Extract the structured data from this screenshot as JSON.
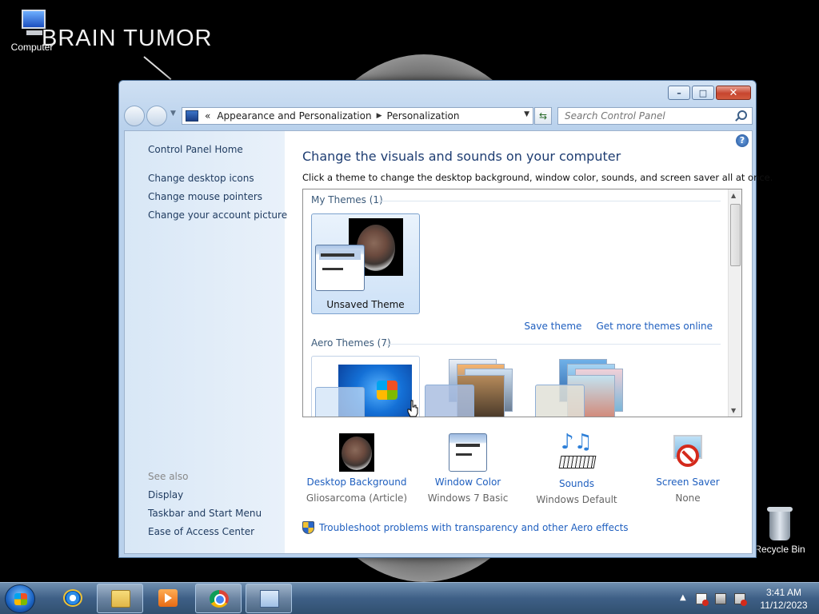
{
  "desktop": {
    "wallpaper_text": "BRAIN TUMOR",
    "icons": {
      "computer": "Computer",
      "recycle_bin": "Recycle Bin"
    }
  },
  "window": {
    "title_buttons": {
      "minimize": "–",
      "maximize": "□",
      "close": "✕"
    },
    "address": {
      "prefix": "«",
      "crumbs": [
        "Appearance and Personalization",
        "Personalization"
      ]
    },
    "search": {
      "placeholder": "Search Control Panel"
    },
    "left_pane": {
      "home": "Control Panel Home",
      "links": [
        "Change desktop icons",
        "Change mouse pointers",
        "Change your account picture"
      ],
      "see_also_label": "See also",
      "see_also": [
        "Display",
        "Taskbar and Start Menu",
        "Ease of Access Center"
      ]
    },
    "main": {
      "title": "Change the visuals and sounds on your computer",
      "subtitle": "Click a theme to change the desktop background, window color, sounds, and screen saver all at once.",
      "my_themes_label": "My Themes (1)",
      "unsaved_theme_name": "Unsaved Theme",
      "save_theme": "Save theme",
      "get_more_themes": "Get more themes online",
      "aero_themes_label": "Aero Themes (7)",
      "bottom_items": [
        {
          "label": "Desktop Background",
          "value": "Gliosarcoma (Article)"
        },
        {
          "label": "Window Color",
          "value": "Windows 7 Basic"
        },
        {
          "label": "Sounds",
          "value": "Windows Default"
        },
        {
          "label": "Screen Saver",
          "value": "None"
        }
      ],
      "troubleshoot": "Troubleshoot problems with transparency and other Aero effects"
    }
  },
  "taskbar": {
    "clock": {
      "time": "3:41 AM",
      "date": "11/12/2023"
    }
  }
}
